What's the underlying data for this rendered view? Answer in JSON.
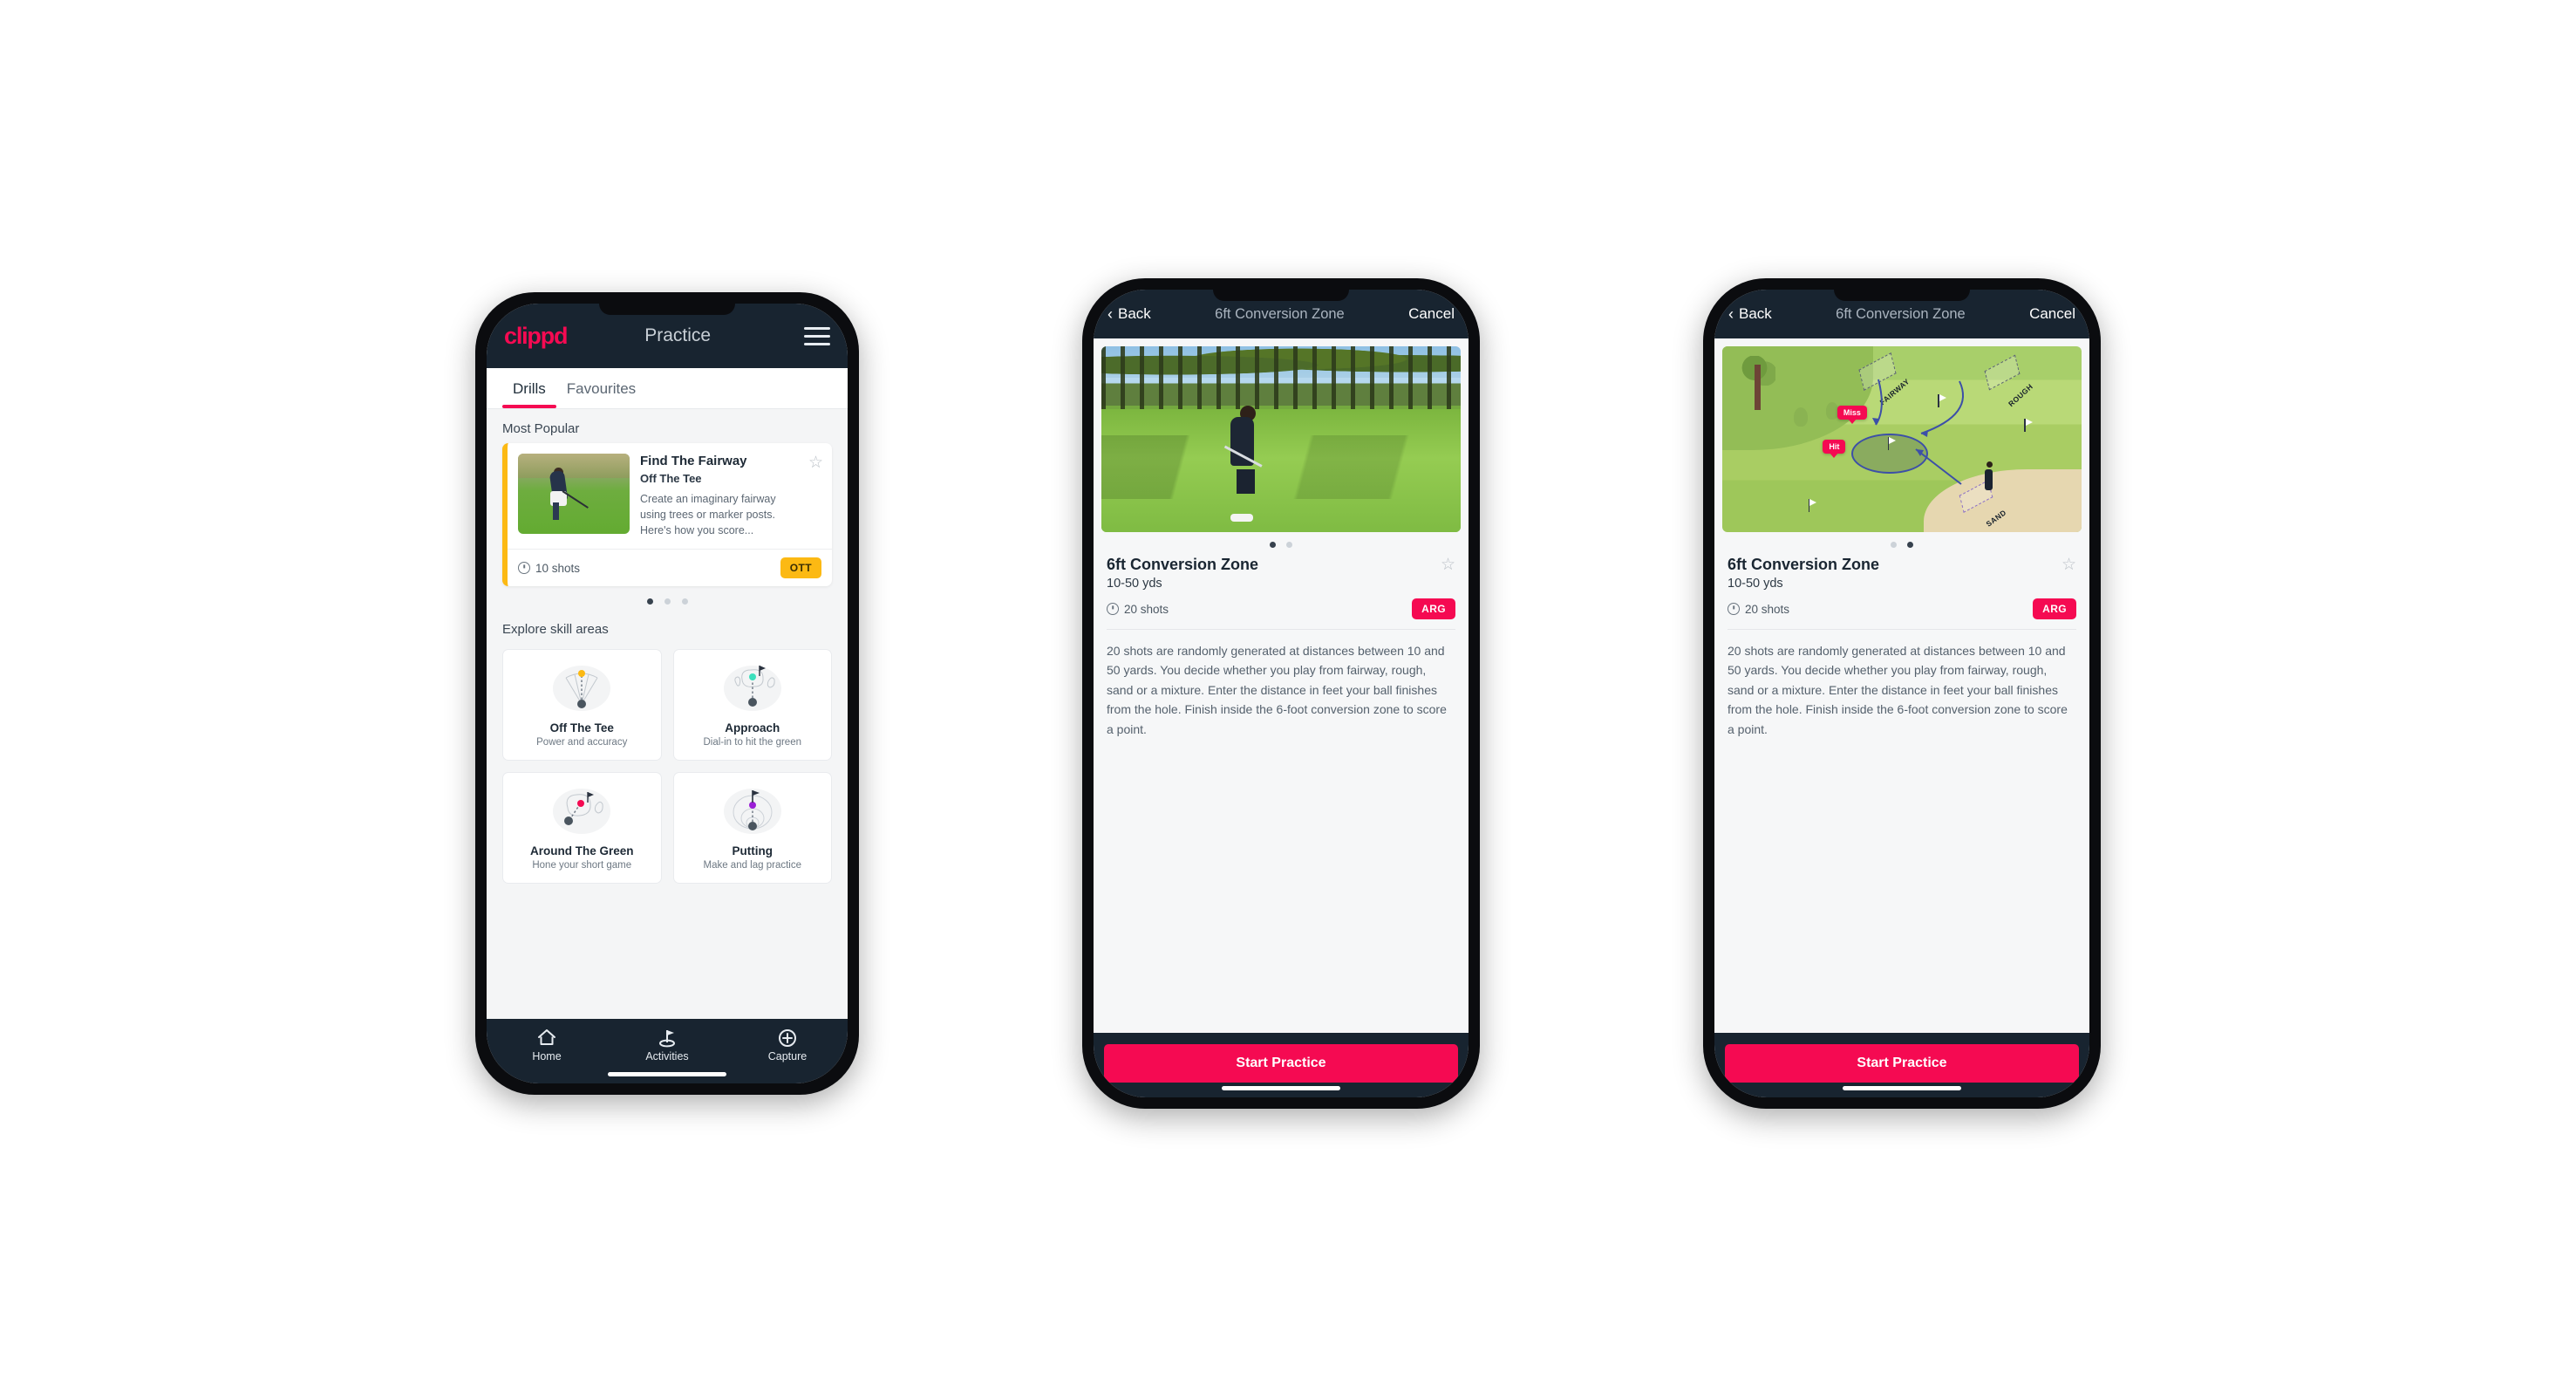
{
  "brand": {
    "logo_text": "clippd",
    "accent_pink": "#f50a52",
    "navy": "#182430",
    "amber": "#fcb913",
    "teal": "#3ce0bd"
  },
  "phone1": {
    "header": {
      "title": "Practice",
      "menu_icon": "hamburger-icon"
    },
    "tabs": [
      {
        "label": "Drills",
        "active": true
      },
      {
        "label": "Favourites",
        "active": false
      }
    ],
    "most_popular": {
      "section_label": "Most Popular",
      "card": {
        "title": "Find The Fairway",
        "subtitle": "Off The Tee",
        "description": "Create an imaginary fairway using trees or marker posts. Here's how you score...",
        "shots": "10 shots",
        "badge": "OTT",
        "star_icon": "star-outline-icon",
        "accent_color": "#fcb913"
      },
      "dots": [
        {
          "active": true
        },
        {
          "active": false
        },
        {
          "active": false
        }
      ]
    },
    "skill_areas": {
      "section_label": "Explore skill areas",
      "cards": [
        {
          "name": "Off The Tee",
          "desc": "Power and accuracy",
          "icon": "tee-fan-icon",
          "dot_color": "#fcb913"
        },
        {
          "name": "Approach",
          "desc": "Dial-in to hit the green",
          "icon": "approach-green-icon",
          "dot_color": "#3ce0bd"
        },
        {
          "name": "Around The Green",
          "desc": "Hone your short game",
          "icon": "chip-green-icon",
          "dot_color": "#f50a52"
        },
        {
          "name": "Putting",
          "desc": "Make and lag practice",
          "icon": "putting-rings-icon",
          "dot_color": "#9b1fd6"
        }
      ]
    },
    "bottom_nav": [
      {
        "label": "Home",
        "icon": "home-icon",
        "active": false
      },
      {
        "label": "Activities",
        "icon": "golf-flag-icon",
        "active": true
      },
      {
        "label": "Capture",
        "icon": "plus-circle-icon",
        "active": false
      }
    ]
  },
  "phone2": {
    "header": {
      "back": "Back",
      "title": "6ft Conversion Zone",
      "cancel": "Cancel",
      "back_icon": "chevron-left-icon"
    },
    "hero_type": "photo",
    "dots": [
      {
        "active": true
      },
      {
        "active": false
      }
    ],
    "detail": {
      "name": "6ft Conversion Zone",
      "distance": "10-50 yds",
      "shots": "20 shots",
      "badge": "ARG",
      "star_icon": "star-outline-icon",
      "description": "20 shots are randomly generated at distances between 10 and 50 yards. You decide whether you play from fairway, rough, sand or a mixture. Enter the distance in feet your ball finishes from the hole. Finish inside the 6-foot conversion zone to score a point."
    },
    "cta": "Start Practice"
  },
  "phone3": {
    "header": {
      "back": "Back",
      "title": "6ft Conversion Zone",
      "cancel": "Cancel",
      "back_icon": "chevron-left-icon"
    },
    "hero_type": "illustration",
    "illustration": {
      "zone_labels": [
        "FAIRWAY",
        "ROUGH",
        "SAND"
      ],
      "markers": [
        "Miss",
        "Hit"
      ]
    },
    "dots": [
      {
        "active": false
      },
      {
        "active": true
      }
    ],
    "detail": {
      "name": "6ft Conversion Zone",
      "distance": "10-50 yds",
      "shots": "20 shots",
      "badge": "ARG",
      "star_icon": "star-outline-icon",
      "description": "20 shots are randomly generated at distances between 10 and 50 yards. You decide whether you play from fairway, rough, sand or a mixture. Enter the distance in feet your ball finishes from the hole. Finish inside the 6-foot conversion zone to score a point."
    },
    "cta": "Start Practice"
  }
}
